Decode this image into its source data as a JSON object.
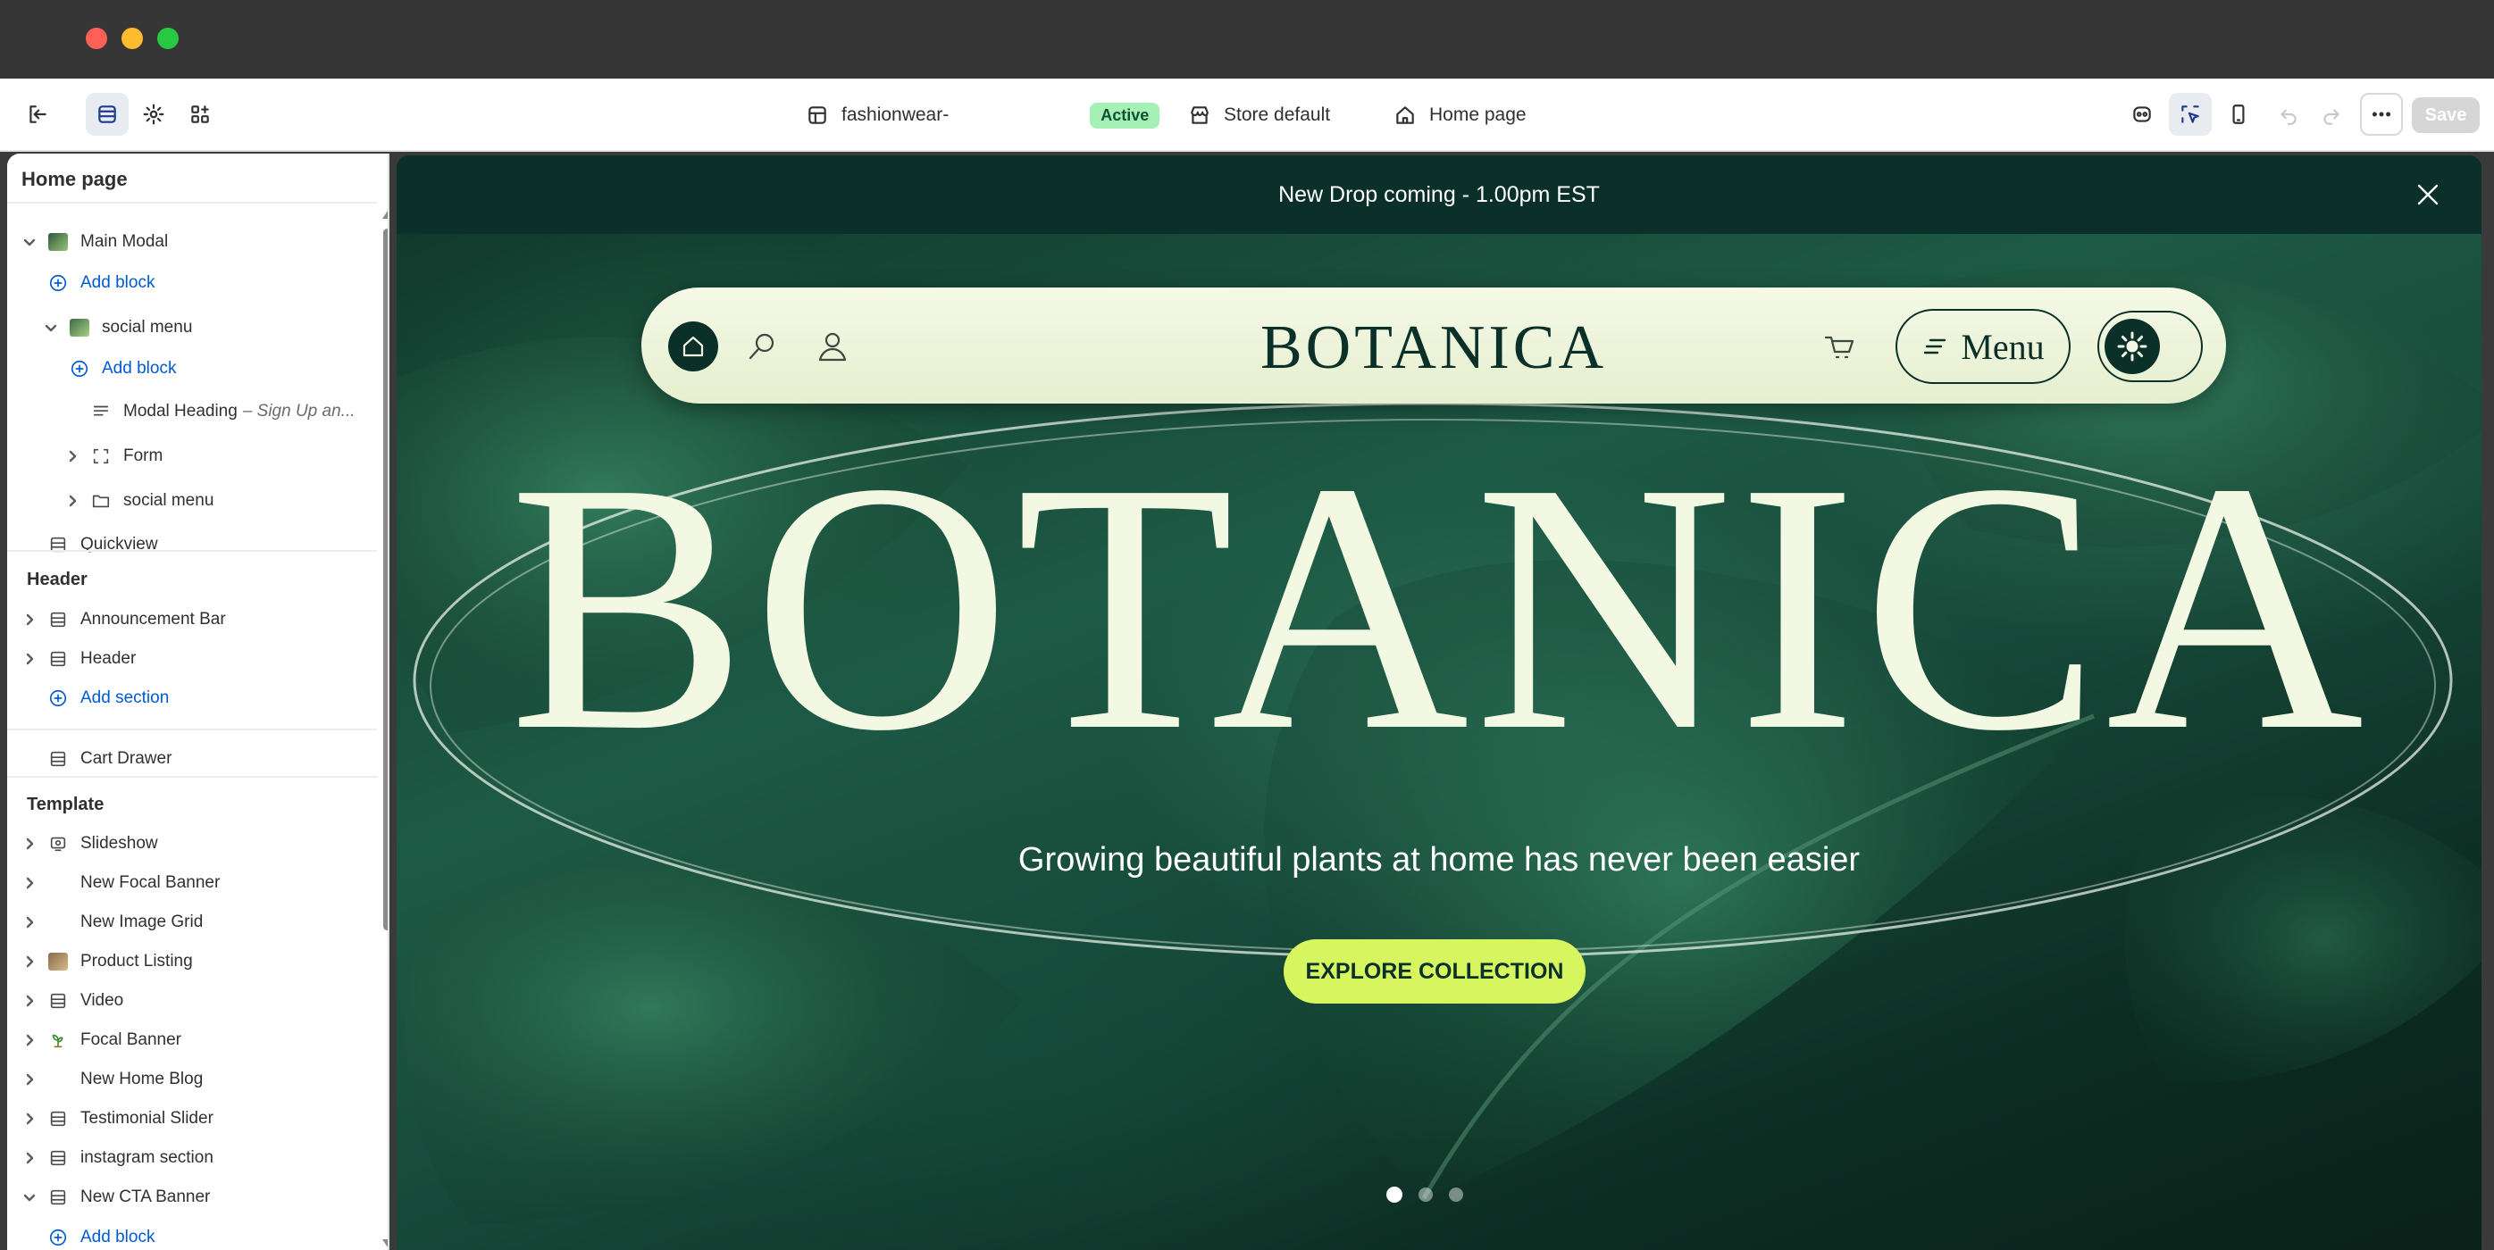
{
  "window": {
    "controls": [
      "close",
      "minimize",
      "zoom"
    ]
  },
  "topbar": {
    "theme_name": "fashionwear-",
    "theme_status": "Active",
    "store": "Store default",
    "page": "Home page",
    "save_label": "Save"
  },
  "sidebar": {
    "title": "Home page",
    "modal_items": [
      {
        "label": "Main Modal",
        "icon": "image-icon"
      },
      {
        "label": "Add block",
        "icon": "add-circle-icon"
      },
      {
        "label": "social menu",
        "icon": "image-icon"
      },
      {
        "label": "Add block",
        "icon": "add-circle-icon"
      },
      {
        "label": "Modal Heading",
        "sub": "– Sign Up an...",
        "icon": "text-icon"
      },
      {
        "label": "Form",
        "icon": "frame-icon"
      },
      {
        "label": "social menu",
        "icon": "folder-icon"
      },
      {
        "label": "Quickview",
        "icon": "section-icon"
      }
    ],
    "header_group": {
      "title": "Header",
      "items": [
        "Announcement Bar",
        "Header"
      ],
      "add_label": "Add section"
    },
    "cart_drawer": "Cart Drawer",
    "template_group": {
      "title": "Template",
      "items": [
        "Slideshow",
        "New Focal Banner",
        "New Image Grid",
        "Product Listing",
        "Video",
        "Focal Banner",
        "New Home Blog",
        "Testimonial Slider",
        "instagram section",
        "New CTA Banner"
      ],
      "add_block": "Add block"
    }
  },
  "preview": {
    "announcement": "New Drop coming - 1.00pm EST",
    "logo": "BOTANICA",
    "menu_label": "Menu",
    "hero_title": "BOTANICA",
    "tagline": "Growing beautiful plants at home has never been easier",
    "cta_label": "EXPLORE COLLECTION",
    "slides_total": 3,
    "active_slide": 1
  },
  "colors": {
    "accent_blue": "#005bd3",
    "announce_bg": "#0b3029",
    "cta_bg": "#d6f55f",
    "active_badge": "#a5f0b4"
  }
}
